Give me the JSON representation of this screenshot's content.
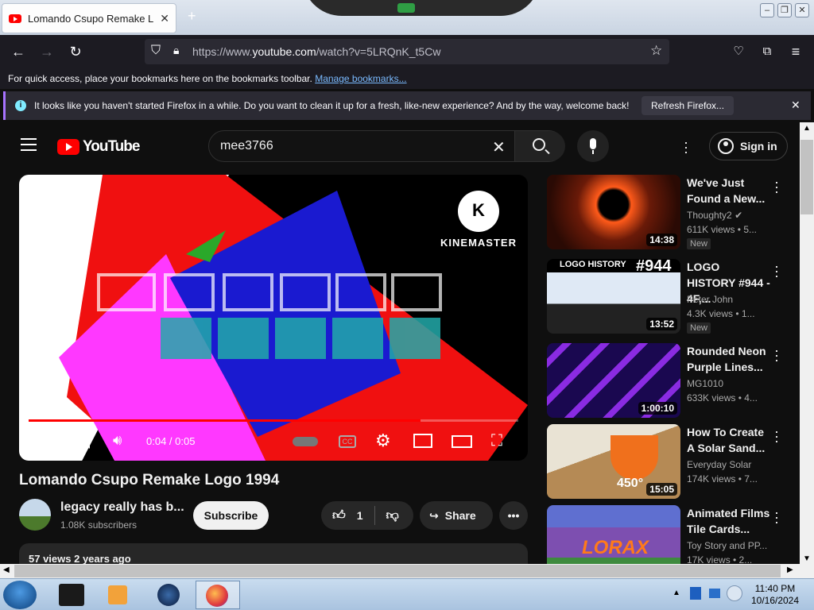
{
  "browser": {
    "tab_title": "Lomando Csupo Remake Logo",
    "new_tab": "+",
    "url_prefix": "https://www.",
    "url_host": "youtube.com",
    "url_path": "/watch?v=5LRQnK_t5Cw",
    "bookmarks_text": "For quick access, place your bookmarks here on the bookmarks toolbar.",
    "bookmarks_link": "Manage bookmarks...",
    "notice_text": "It looks like you haven't started Firefox in a while. Do you want to clean it up for a fresh, like-new experience? And by the way, welcome back!",
    "notice_button": "Refresh Firefox..."
  },
  "youtube": {
    "logo_text": "YouTube",
    "search_value": "mee3766",
    "signin_label": "Sign in"
  },
  "player": {
    "time": "0:04 / 0:05",
    "progress": 0.8,
    "watermark": "KINEMASTER",
    "watermark_letter": "K"
  },
  "video": {
    "title": "Lomando Csupo Remake Logo 1994",
    "channel": "legacy really has b...",
    "subscribers": "1.08K subscribers",
    "subscribe_label": "Subscribe",
    "likes": "1",
    "share_label": "Share",
    "views_date": "57 views  2 years ago"
  },
  "recommendations": [
    {
      "title": "We've Just Found a New...",
      "channel": "Thoughty2",
      "meta": "611K views  • 5...",
      "badge": "New",
      "duration": "14:38",
      "color": "#3a1208"
    },
    {
      "title": "LOGO HISTORY #944 - 4F,...",
      "channel": "Peter John",
      "meta": "4.3K views  • 1...",
      "badge": "New",
      "duration": "13:52",
      "color": "#dfe9f5"
    },
    {
      "title": "Rounded Neon Purple Lines...",
      "channel": "MG1010",
      "meta": "633K views  • 4...",
      "badge": "",
      "duration": "1:00:10",
      "color": "#2a0a6b"
    },
    {
      "title": "How To Create A Solar Sand...",
      "channel": "Everyday Solar",
      "meta": "174K views  • 7...",
      "badge": "",
      "duration": "15:05",
      "color": "#c8b089"
    },
    {
      "title": "Animated Films Tile Cards...",
      "channel": "Toy Story and PP...",
      "meta": "17K views  • 2...",
      "badge": "",
      "duration": "",
      "color": "#7d4fb0"
    }
  ],
  "thumb_overlay": {
    "logo_history": "LOGO HISTORY",
    "number": "#944",
    "degree": "450°",
    "lorax": "LORAX"
  },
  "taskbar": {
    "time": "11:40 PM",
    "date": "10/16/2024"
  }
}
